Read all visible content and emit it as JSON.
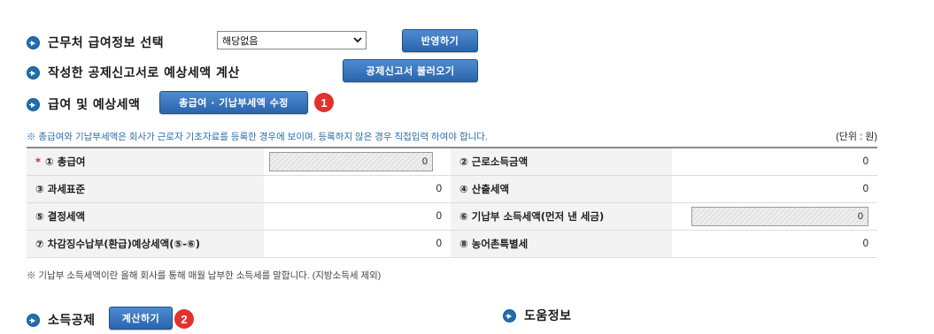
{
  "sections": {
    "employer": {
      "label": "근무처 급여정보 선택",
      "select_value": "해당없음",
      "apply_button": "반영하기"
    },
    "deduction_report": {
      "label": "작성한 공제신고서로 예상세액 계산",
      "load_button": "공제신고서 불러오기"
    },
    "salary": {
      "label": "급여 및 예상세액",
      "edit_button": "총급여 · 기납부세액 수정",
      "badge": "1"
    },
    "income_deduction": {
      "label": "소득공제",
      "calc_button": "계산하기",
      "badge": "2"
    },
    "help": {
      "label": "도움정보"
    }
  },
  "notes": {
    "top": "※ 총급여와 기납부세액은 회사가 근로자 기초자료를 등록한 경우에 보이며, 등록하지 않은 경우 직접입력 하여야 합니다.",
    "unit": "(단위 : 원)",
    "bottom": "※ 기납부 소득세액이란 올해 회사를 통해 매월 납부한 소득세를 말합니다. (지방소득세 제외)"
  },
  "table": {
    "rows": [
      {
        "l1": "① 총급여",
        "v1": "0",
        "l2": "② 근로소득금액",
        "v2": "0",
        "required": "*"
      },
      {
        "l1": "③ 과세표준",
        "v1": "0",
        "l2": "④ 산출세액",
        "v2": "0"
      },
      {
        "l1": "⑤ 결정세액",
        "v1": "0",
        "l2": "⑥ 기납부 소득세액(먼저 낸 세금)",
        "v2": "0"
      },
      {
        "l1": "⑦ 차감징수납부(환급)예상세액(⑤-⑥)",
        "v1": "0",
        "l2": "⑧ 농어촌특별세",
        "v2": "0"
      }
    ]
  },
  "colors": {
    "button": "#2a65ad",
    "badge": "#e0322f",
    "note": "#2a6ea8",
    "arrow": "#1e6fb0"
  },
  "icons": {
    "section": "arrow-circle-icon",
    "select": "chevron-down-icon"
  }
}
